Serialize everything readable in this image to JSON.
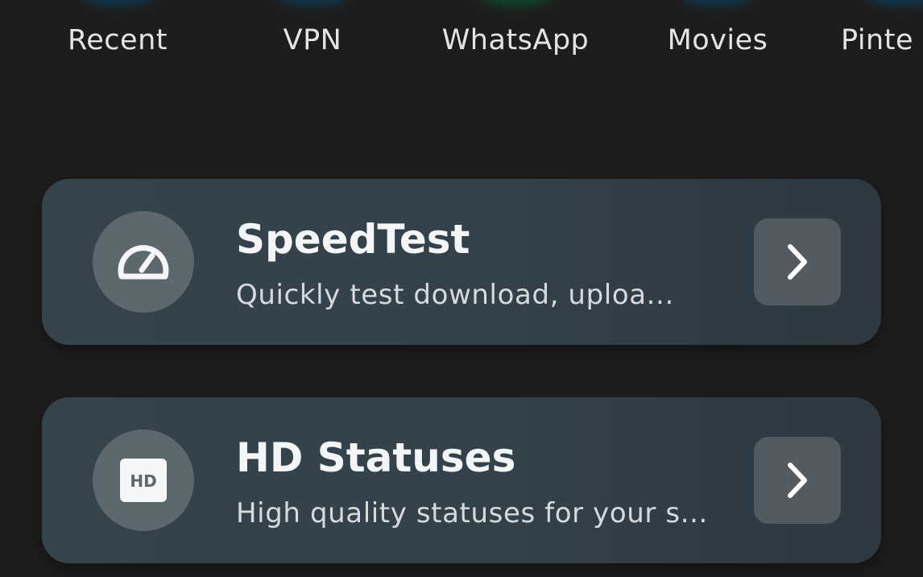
{
  "shortcuts": [
    {
      "label": "Recent",
      "icon": "recent-icon"
    },
    {
      "label": "VPN",
      "icon": "vpn-icon"
    },
    {
      "label": "WhatsApp",
      "icon": "whatsapp-icon"
    },
    {
      "label": "Movies",
      "icon": "movies-icon"
    },
    {
      "label": "Pinte",
      "icon": "pinterest-icon"
    }
  ],
  "cards": [
    {
      "title": "SpeedTest",
      "subtitle": "Quickly test download, uploa...",
      "icon": "speedometer-icon"
    },
    {
      "title": "HD Statuses",
      "subtitle": "High quality statuses for your s...",
      "icon": "hd-icon",
      "icon_text": "HD"
    }
  ],
  "colors": {
    "background": "#1d1d1d",
    "card": "#35434d",
    "icon_circle": "#5d676e",
    "arrow_button": "#535b61",
    "text_primary": "#f3f5f6",
    "text_secondary": "#d6dadd"
  }
}
